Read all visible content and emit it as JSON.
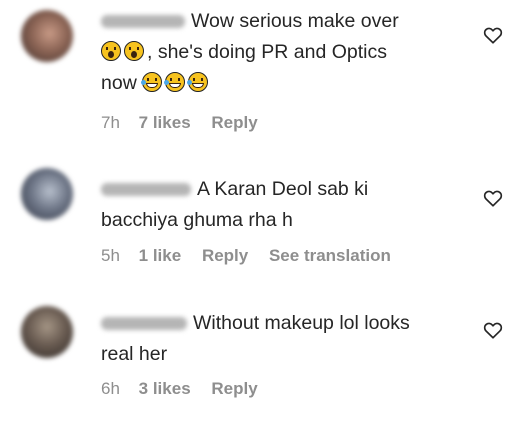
{
  "comments": [
    {
      "text_lines": [
        "Wow serious make over",
        ", she's doing PR and Optics",
        "now"
      ],
      "time": "7h",
      "likes": "7 likes",
      "reply": "Reply"
    },
    {
      "text_lines": [
        "A Karan Deol sab ki",
        "bacchiya ghuma rha h"
      ],
      "time": "5h",
      "likes": "1 like",
      "reply": "Reply",
      "translation": "See translation"
    },
    {
      "text_lines": [
        "Without makeup lol looks",
        "real her"
      ],
      "time": "6h",
      "likes": "3 likes",
      "reply": "Reply"
    }
  ],
  "colors": {
    "text": "#262626",
    "meta": "#8e8e8e"
  },
  "icons": {
    "like": "heart-outline-icon",
    "emoji_1": "hushed-face-emoji",
    "emoji_2": "tears-of-joy-emoji"
  }
}
